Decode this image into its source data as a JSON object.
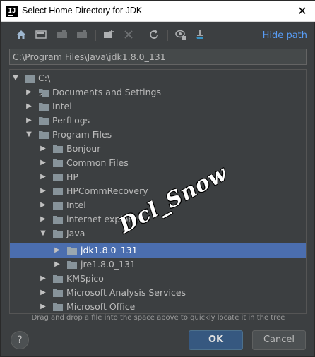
{
  "window": {
    "title": "Select Home Directory for JDK",
    "app_icon": "IJ",
    "close_glyph": "✕"
  },
  "toolbar": {
    "icons": [
      "home-icon",
      "desktop-icon",
      "project-icon",
      "module-icon",
      "new-folder-icon",
      "delete-icon",
      "refresh-icon",
      "show-hidden-icon",
      "jdk-icon"
    ],
    "hide_path_label": "Hide path"
  },
  "path_field": {
    "value": "C:\\Program Files\\Java\\jdk1.8.0_131"
  },
  "tree": {
    "items": [
      {
        "label": "C:\\"
      },
      {
        "label": "Documents and Settings"
      },
      {
        "label": "Intel"
      },
      {
        "label": "PerfLogs"
      },
      {
        "label": "Program Files"
      },
      {
        "label": "Bonjour"
      },
      {
        "label": "Common Files"
      },
      {
        "label": "HP"
      },
      {
        "label": "HPCommRecovery"
      },
      {
        "label": "Intel"
      },
      {
        "label": "internet explorer"
      },
      {
        "label": "Java"
      },
      {
        "label": "jdk1.8.0_131"
      },
      {
        "label": "jre1.8.0_131"
      },
      {
        "label": "KMSpico"
      },
      {
        "label": "Microsoft Analysis Services"
      },
      {
        "label": "Microsoft Office"
      }
    ]
  },
  "hint": "Drag and drop a file into the space above to quickly locate it in the tree",
  "watermark": "Dcl_Snow",
  "footer": {
    "help_label": "?",
    "ok_label": "OK",
    "cancel_label": "Cancel"
  },
  "colors": {
    "background": "#3c3f41",
    "selection": "#4b6eaf",
    "link": "#589df6",
    "ok_button": "#365880",
    "folder": "#87939a"
  }
}
